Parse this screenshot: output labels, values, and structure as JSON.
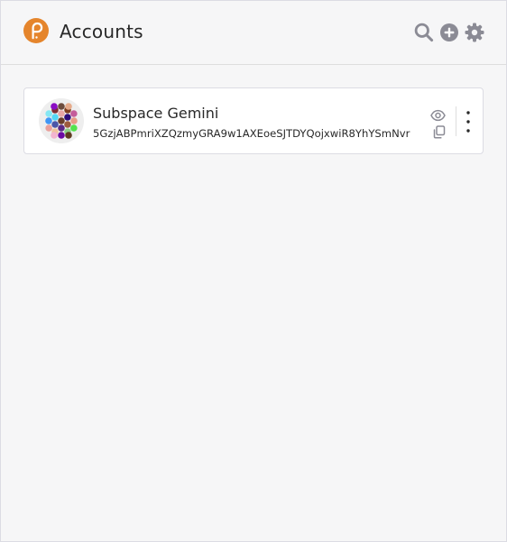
{
  "app": {
    "title": "Accounts"
  },
  "header": {
    "icons": [
      "logo-icon",
      "search-icon",
      "add-icon",
      "settings-icon"
    ]
  },
  "accounts": [
    {
      "name": "Subspace Gemini",
      "address": "5GzjABPmriXZQzmyGRA9w1AXEoeSJTDYQojxwiR8YhYSmNvr",
      "icons": [
        "identicon",
        "eye-icon",
        "copy-icon",
        "more-options-icon"
      ]
    }
  ],
  "colors": {
    "brand": "#e5852c",
    "icon_gray": "#8b8b95",
    "background": "#f6f6f7",
    "card": "#ffffff",
    "text": "#282828",
    "identicon_dots": [
      "#6a3e2c",
      "#9d5c3e",
      "#5b2a86",
      "#4a56a8",
      "#53d7f5",
      "#e7a7a5",
      "#2c0d79",
      "#6d4c3d",
      "#7f3e1f",
      "#c45c9a",
      "#e89b87",
      "#52e34d",
      "#8dcf87",
      "#6b0aa3",
      "#f0c39d",
      "#e9a09c",
      "#3f96f5",
      "#85e7f3",
      "#7f2d32",
      "#8a0dc3",
      "#e6ab8b",
      "#f2b4cf",
      "#5f3b20"
    ]
  }
}
